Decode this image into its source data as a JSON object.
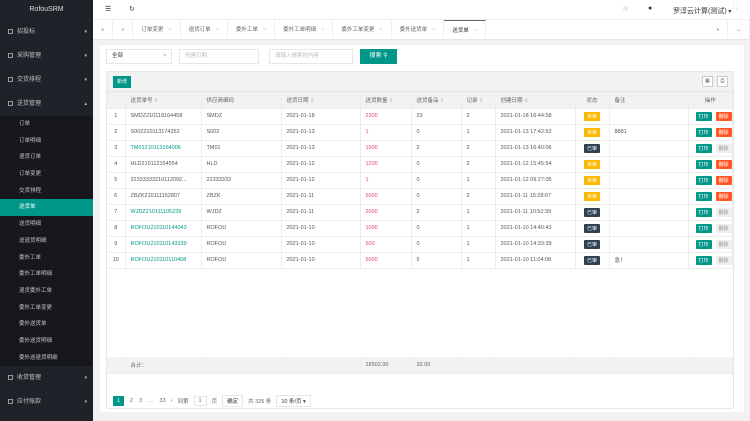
{
  "app": {
    "title": "RofouSRM",
    "user": "罗淳云计算(测试)"
  },
  "sidebar": {
    "groups": [
      {
        "label": "招投标"
      },
      {
        "label": "采购管理"
      },
      {
        "label": "交货排程"
      },
      {
        "label": "送货管理"
      }
    ],
    "sub": [
      "订单",
      "订单明细",
      "退货订单",
      "订单变更",
      "交货排程",
      "送货单",
      "送货明细",
      "送退货明细",
      "委外工单",
      "委外工单明细",
      "退货委外工单",
      "委外工单变更",
      "委外送货单",
      "委外送货明细",
      "委外送退货明细"
    ],
    "after": [
      {
        "label": "收货管理"
      },
      {
        "label": "应付账款"
      }
    ]
  },
  "tabs": [
    "订单变更",
    "退货订单",
    "委外工单",
    "委外工单明细",
    "委外工单变更",
    "委外送货单",
    "送货单"
  ],
  "search": {
    "select": "全部",
    "date_placeholder": "创建日期",
    "keyword_placeholder": "请输入搜索的内容",
    "button": "搜索"
  },
  "toolbar": {
    "add": "新增"
  },
  "table": {
    "headers": [
      "",
      "送货单号",
      "供应商编码",
      "送货日期",
      "送货数量",
      "送货备品",
      "记录",
      "创建日期",
      "状态",
      "备注",
      "操作"
    ],
    "rows": [
      {
        "n": "1",
        "no": "SMDZ210118164458",
        "sup": "SMDZ",
        "date": "2021-01-18",
        "qty": "2300",
        "spare": "23",
        "rec": "2",
        "created": "2021-01-18 16:44:58",
        "status": "未审",
        "note": "",
        "link": false,
        "del": true
      },
      {
        "n": "2",
        "no": "S002210113174252",
        "sup": "S002",
        "date": "2021-01-13",
        "qty": "1",
        "spare": "0",
        "rec": "1",
        "created": "2021-01-13 17:42:52",
        "status": "未审",
        "note": "8881",
        "link": false,
        "del": true
      },
      {
        "n": "3",
        "no": "TM01210113164006",
        "sup": "TM01",
        "date": "2021-01-13",
        "qty": "1500",
        "spare": "2",
        "rec": "2",
        "created": "2021-01-13 16:40:06",
        "status": "已审",
        "note": "",
        "link": true,
        "del": false
      },
      {
        "n": "4",
        "no": "HLD210112154554",
        "sup": "HLD",
        "date": "2021-01-12",
        "qty": "1200",
        "spare": "0",
        "rec": "2",
        "created": "2021-01-12 15:45:54",
        "status": "未审",
        "note": "",
        "link": false,
        "del": true
      },
      {
        "n": "5",
        "no": "22333333210112092...",
        "sup": "22333333",
        "date": "2021-01-12",
        "qty": "1",
        "spare": "0",
        "rec": "1",
        "created": "2021-01-12 09:27:05",
        "status": "未审",
        "note": "",
        "link": false,
        "del": true
      },
      {
        "n": "6",
        "no": "ZBZK210111152807",
        "sup": "ZBZK",
        "date": "2021-01-11",
        "qty": "5000",
        "spare": "0",
        "rec": "2",
        "created": "2021-01-11 15:28:07",
        "status": "未审",
        "note": "",
        "link": false,
        "del": true
      },
      {
        "n": "7",
        "no": "WJDZ210111105239",
        "sup": "WJDZ",
        "date": "2021-01-11",
        "qty": "2000",
        "spare": "2",
        "rec": "1",
        "created": "2021-01-11 10:52:39",
        "status": "已审",
        "note": "",
        "link": true,
        "del": false
      },
      {
        "n": "8",
        "no": "ROFOU210110144043",
        "sup": "ROFOU",
        "date": "2021-01-10",
        "qty": "1000",
        "spare": "0",
        "rec": "1",
        "created": "2021-01-10 14:40:43",
        "status": "已审",
        "note": "",
        "link": true,
        "del": false
      },
      {
        "n": "9",
        "no": "ROFOU210110143339",
        "sup": "ROFOU",
        "date": "2021-01-10",
        "qty": "500",
        "spare": "0",
        "rec": "1",
        "created": "2021-01-10 14:33:39",
        "status": "已审",
        "note": "",
        "link": true,
        "del": false
      },
      {
        "n": "10",
        "no": "ROFOU210110110408",
        "sup": "ROFOU",
        "date": "2021-01-10",
        "qty": "5000",
        "spare": "5",
        "rec": "1",
        "created": "2021-01-10 11:04:08",
        "status": "已审",
        "note": "急！",
        "link": true,
        "del": false
      }
    ],
    "actions": {
      "print": "打印",
      "delete": "删除"
    },
    "total": {
      "label": "合计：",
      "qty": "18502.00",
      "spare": "32.00"
    }
  },
  "pagination": {
    "pages": [
      "1",
      "2",
      "3",
      "…",
      "33"
    ],
    "goto": "到第",
    "page_value": "1",
    "page_unit": "页",
    "confirm": "确定",
    "total": "共 325 条",
    "per_page": "10 条/页"
  },
  "colors": {
    "accent": "#009688",
    "pending": "#ffb800",
    "approved": "#2f4056",
    "danger": "#ff5722"
  }
}
